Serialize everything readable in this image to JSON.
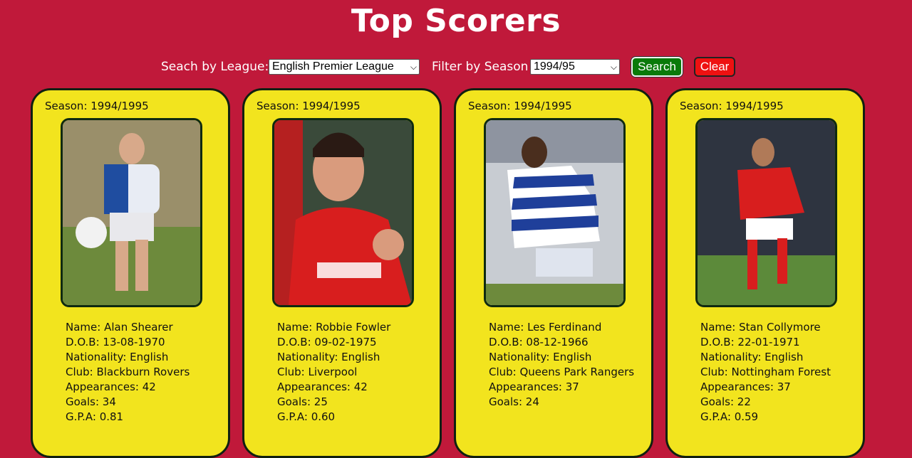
{
  "page": {
    "title": "Top Scorers"
  },
  "controls": {
    "league_label": "Seach by League:",
    "league_value": "English Premier League",
    "season_label": "Filter by Season",
    "season_value": "1994/95",
    "search_label": "Search",
    "clear_label": "Clear"
  },
  "colors": {
    "background": "#c0193a",
    "card": "#f2e41e",
    "search_button": "#0a7a0a",
    "clear_button": "#ee1111"
  },
  "cards": [
    {
      "season": "Season: 1994/1995",
      "photo_icon": "player-photo",
      "name": "Name: Alan Shearer",
      "dob": "D.O.B: 13-08-1970",
      "nationality": "Nationality: English",
      "club": "Club: Blackburn Rovers",
      "appearances": "Appearances: 42",
      "goals": "Goals: 34",
      "gpa": "G.P.A: 0.81"
    },
    {
      "season": "Season: 1994/1995",
      "photo_icon": "player-photo",
      "name": "Name: Robbie Fowler",
      "dob": "D.O.B: 09-02-1975",
      "nationality": "Nationality: English",
      "club": "Club: Liverpool",
      "appearances": "Appearances: 42",
      "goals": "Goals: 25",
      "gpa": "G.P.A: 0.60"
    },
    {
      "season": "Season: 1994/1995",
      "photo_icon": "player-photo",
      "name": "Name: Les Ferdinand",
      "dob": "D.O.B: 08-12-1966",
      "nationality": "Nationality: English",
      "club": "Club: Queens Park Rangers",
      "appearances": "Appearances: 37",
      "goals": "Goals: 24",
      "gpa": ""
    },
    {
      "season": "Season: 1994/1995",
      "photo_icon": "player-photo",
      "name": "Name: Stan Collymore",
      "dob": "D.O.B: 22-01-1971",
      "nationality": "Nationality: English",
      "club": "Club: Nottingham Forest",
      "appearances": "Appearances: 37",
      "goals": "Goals: 22",
      "gpa": "G.P.A: 0.59"
    }
  ]
}
